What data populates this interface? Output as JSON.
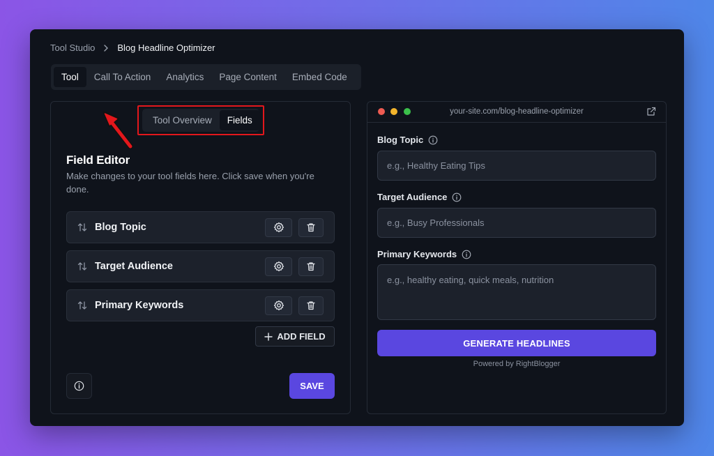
{
  "breadcrumb": {
    "root": "Tool Studio",
    "current": "Blog Headline Optimizer"
  },
  "tabs": [
    {
      "label": "Tool",
      "active": true
    },
    {
      "label": "Call To Action",
      "active": false
    },
    {
      "label": "Analytics",
      "active": false
    },
    {
      "label": "Page Content",
      "active": false
    },
    {
      "label": "Embed Code",
      "active": false
    }
  ],
  "subtabs": [
    {
      "label": "Tool Overview",
      "active": false
    },
    {
      "label": "Fields",
      "active": true
    }
  ],
  "field_editor": {
    "title": "Field Editor",
    "description": "Make changes to your tool fields here. Click save when you're done.",
    "fields": [
      {
        "label": "Blog Topic"
      },
      {
        "label": "Target Audience"
      },
      {
        "label": "Primary Keywords"
      }
    ],
    "add_field_label": "ADD FIELD",
    "save_label": "SAVE"
  },
  "preview": {
    "url": "your-site.com/blog-headline-optimizer",
    "form": [
      {
        "label": "Blog Topic",
        "placeholder": "e.g., Healthy Eating Tips"
      },
      {
        "label": "Target Audience",
        "placeholder": "e.g., Busy Professionals"
      },
      {
        "label": "Primary Keywords",
        "placeholder": "e.g., healthy eating, quick meals, nutrition"
      }
    ],
    "button_label": "GENERATE HEADLINES",
    "powered_by": "Powered by RightBlogger"
  },
  "colors": {
    "accent": "#5a47e0",
    "annotation": "#e3171c",
    "background": "#0f131b"
  },
  "icons": [
    "chevron-right-icon",
    "sort-icon",
    "gear-icon",
    "trash-icon",
    "plus-icon",
    "info-icon",
    "external-link-icon"
  ]
}
